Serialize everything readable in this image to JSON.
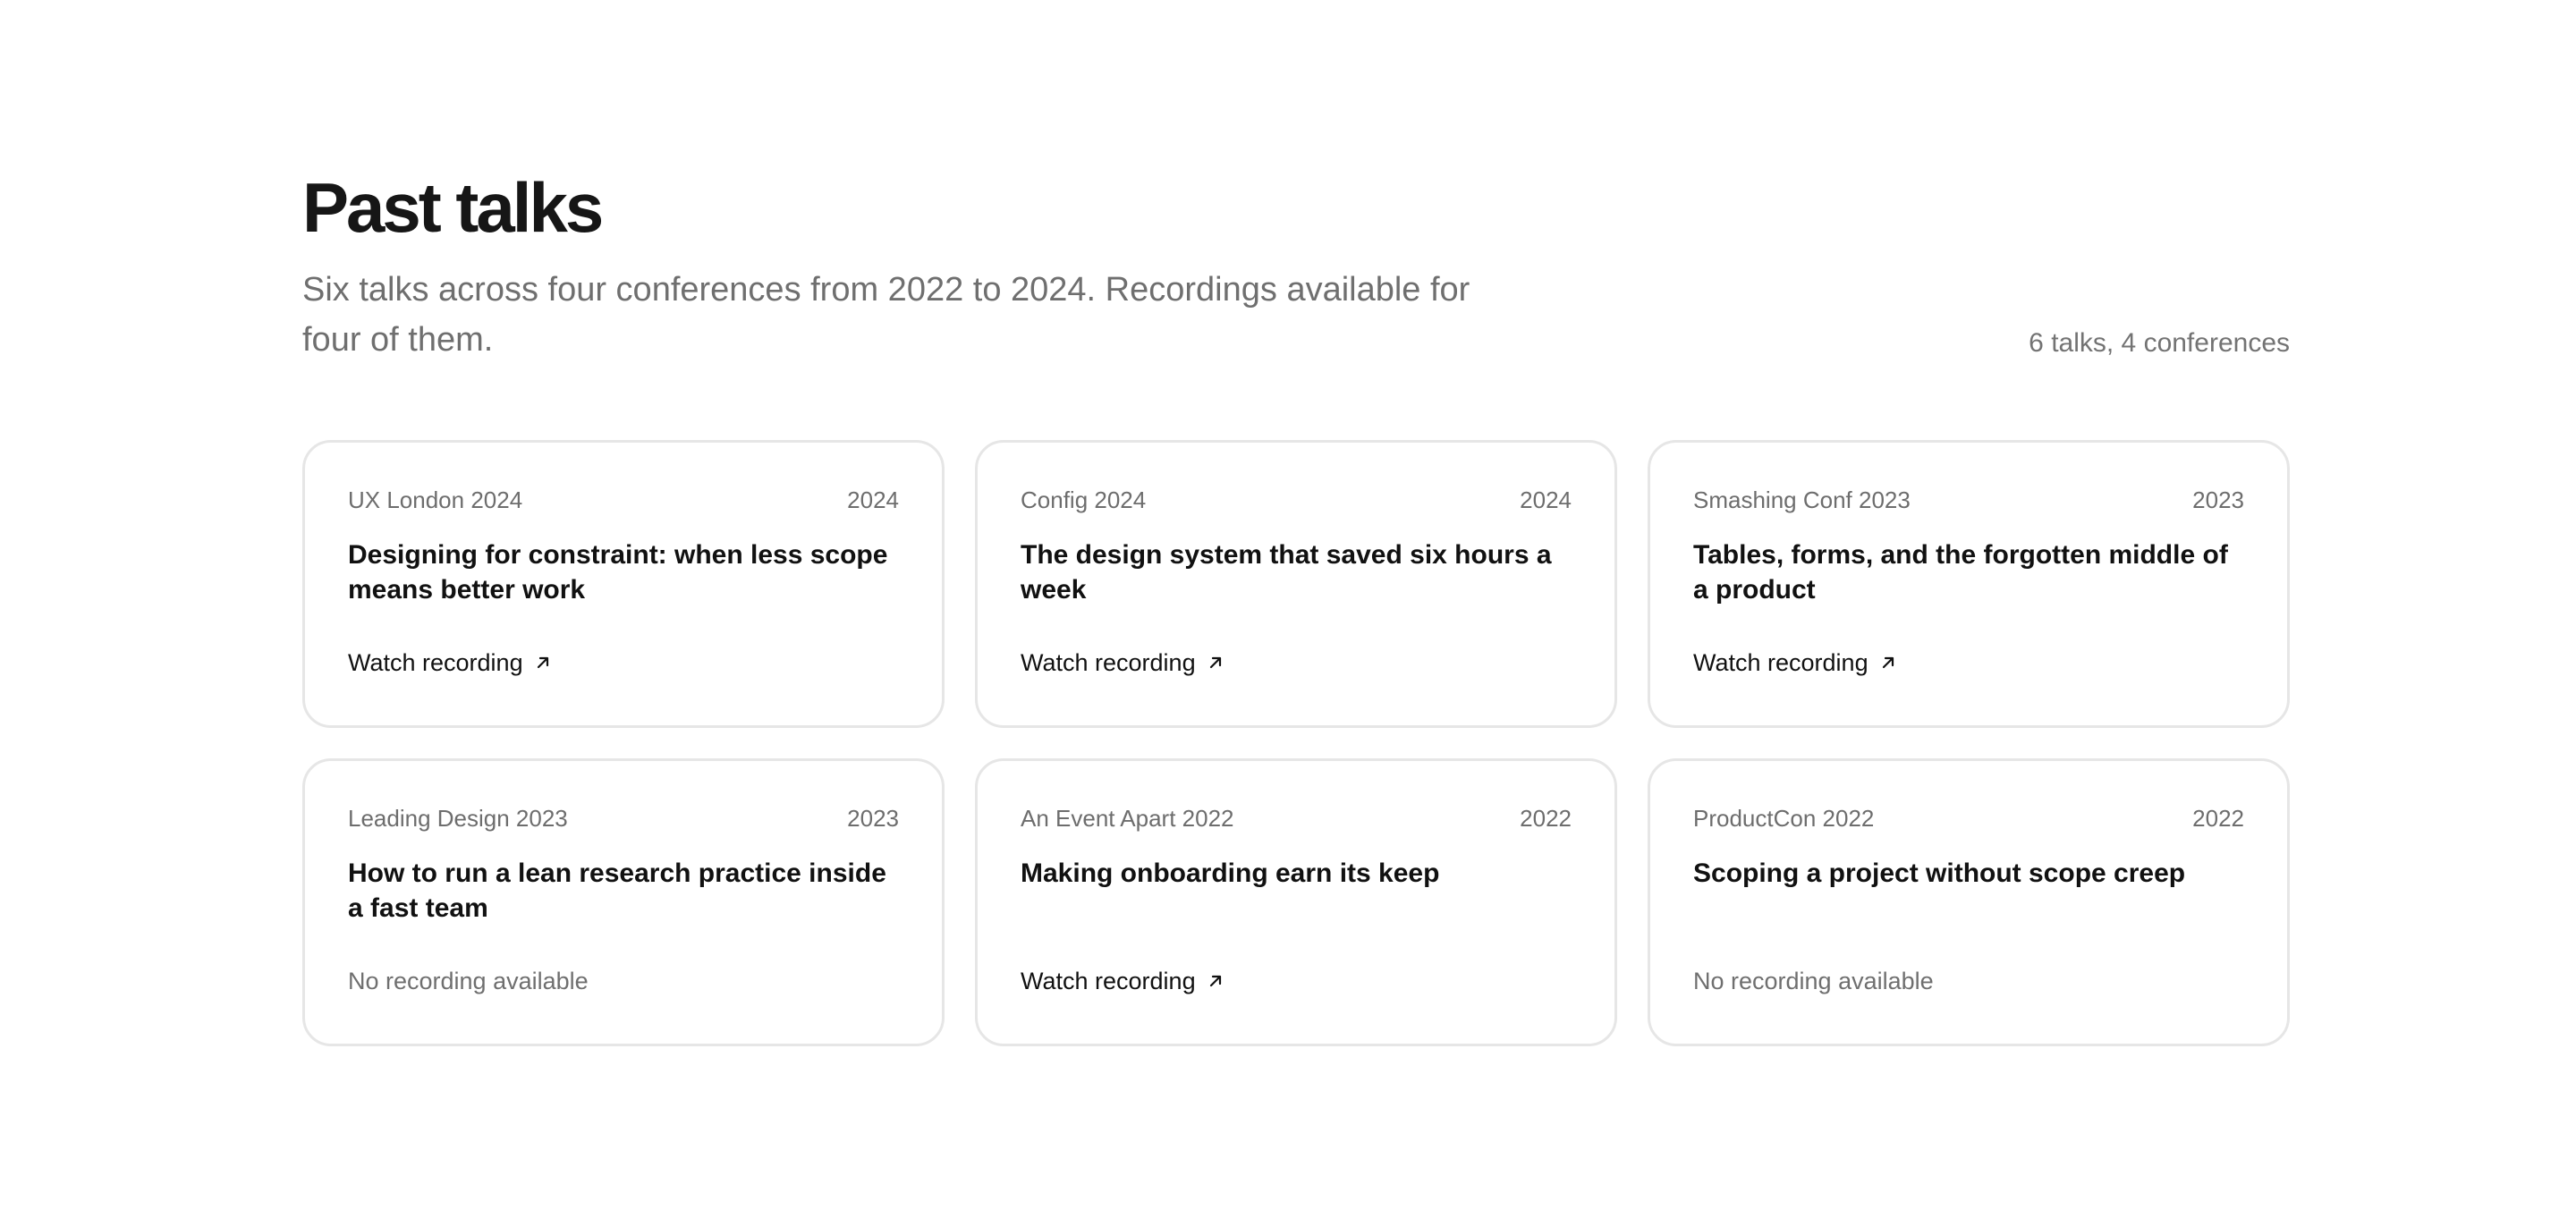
{
  "title": "Past talks",
  "subtitle": "Six talks across four conferences from 2022 to 2024. Recordings available for four of them.",
  "summary": "6 talks, 4 conferences",
  "talks": [
    {
      "conference": "UX London 2024",
      "year": "2024",
      "title": "Designing for constraint: when less scope means better work",
      "footer": "Watch recording",
      "has_recording": true
    },
    {
      "conference": "Config 2024",
      "year": "2024",
      "title": "The design system that saved six hours a week",
      "footer": "Watch recording",
      "has_recording": true
    },
    {
      "conference": "Smashing Conf 2023",
      "year": "2023",
      "title": "Tables, forms, and the forgotten middle of a product",
      "footer": "Watch recording",
      "has_recording": true
    },
    {
      "conference": "Leading Design 2023",
      "year": "2023",
      "title": "How to run a lean research practice inside a fast team",
      "footer": "No recording available",
      "has_recording": false
    },
    {
      "conference": "An Event Apart 2022",
      "year": "2022",
      "title": "Making onboarding earn its keep",
      "footer": "Watch recording",
      "has_recording": true
    },
    {
      "conference": "ProductCon 2022",
      "year": "2022",
      "title": "Scoping a project without scope creep",
      "footer": "No recording available",
      "has_recording": false
    }
  ],
  "icons": {
    "external_link": "arrow-up-right-icon"
  },
  "colors": {
    "text": "#111111",
    "muted": "#6f6f6f",
    "border": "#e6e6e6"
  }
}
